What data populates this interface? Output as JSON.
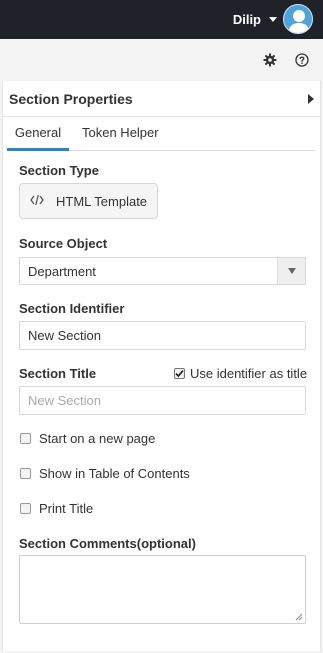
{
  "header": {
    "username": "Dilip"
  },
  "panel": {
    "title": "Section Properties",
    "tabs": [
      {
        "label": "General",
        "active": true
      },
      {
        "label": "Token Helper",
        "active": false
      }
    ]
  },
  "form": {
    "section_type": {
      "label": "Section Type",
      "button_label": "HTML Template"
    },
    "source_object": {
      "label": "Source Object",
      "selected": "Department"
    },
    "section_identifier": {
      "label": "Section Identifier",
      "value": "New Section"
    },
    "section_title": {
      "label": "Section Title",
      "placeholder": "New Section",
      "use_identifier": {
        "label": "Use identifier as title",
        "checked": true
      }
    },
    "checkboxes": [
      {
        "label": "Start on a new page",
        "checked": false
      },
      {
        "label": "Show in Table of Contents",
        "checked": false
      },
      {
        "label": "Print Title",
        "checked": false
      }
    ],
    "comments": {
      "label": "Section Comments(optional)",
      "value": ""
    }
  },
  "colors": {
    "topbar": "#1f2329",
    "accent": "#2a84c6",
    "avatar": "#4ea3d8"
  }
}
